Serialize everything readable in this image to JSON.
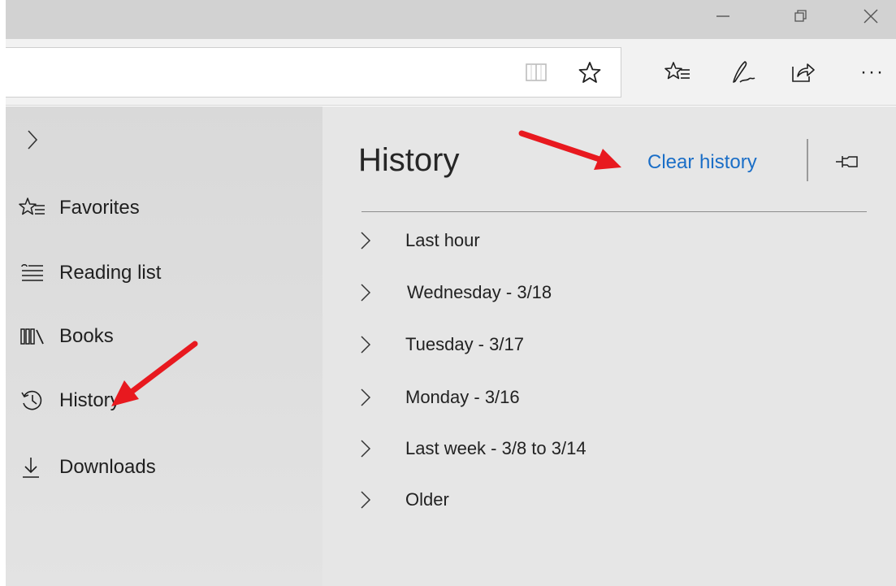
{
  "window": {
    "controls": [
      {
        "name": "minimize-icon",
        "label": "Minimize"
      },
      {
        "name": "restore-icon",
        "label": "Restore"
      },
      {
        "name": "close-icon",
        "label": "Close"
      }
    ]
  },
  "toolbar": {
    "address_value": "",
    "icons": [
      "reading-view-icon",
      "add-favorite-star-icon",
      "favorites-hub-icon",
      "web-note-pen-icon",
      "share-icon",
      "more-ellipsis-icon"
    ],
    "more_label": "···"
  },
  "hub_nav": {
    "items": [
      {
        "label": "Favorites",
        "icon": "favorites-star-icon"
      },
      {
        "label": "Reading list",
        "icon": "reading-list-icon"
      },
      {
        "label": "Books",
        "icon": "books-icon"
      },
      {
        "label": "History",
        "icon": "history-clock-icon"
      },
      {
        "label": "Downloads",
        "icon": "download-arrow-icon"
      }
    ]
  },
  "history_pane": {
    "title": "History",
    "clear_label": "Clear history",
    "groups": [
      {
        "label": "Last hour"
      },
      {
        "label": "Wednesday - 3/18"
      },
      {
        "label": "Tuesday - 3/17"
      },
      {
        "label": "Monday - 3/16"
      },
      {
        "label": "Last week - 3/8 to 3/14"
      },
      {
        "label": "Older"
      }
    ]
  },
  "colors": {
    "link": "#1a6ec7",
    "annotation_arrow": "#e8191f",
    "pane_bg": "#e6e6e6",
    "nav_bg": "#dcdcdc",
    "titlebar_bg": "#d2d2d2"
  }
}
